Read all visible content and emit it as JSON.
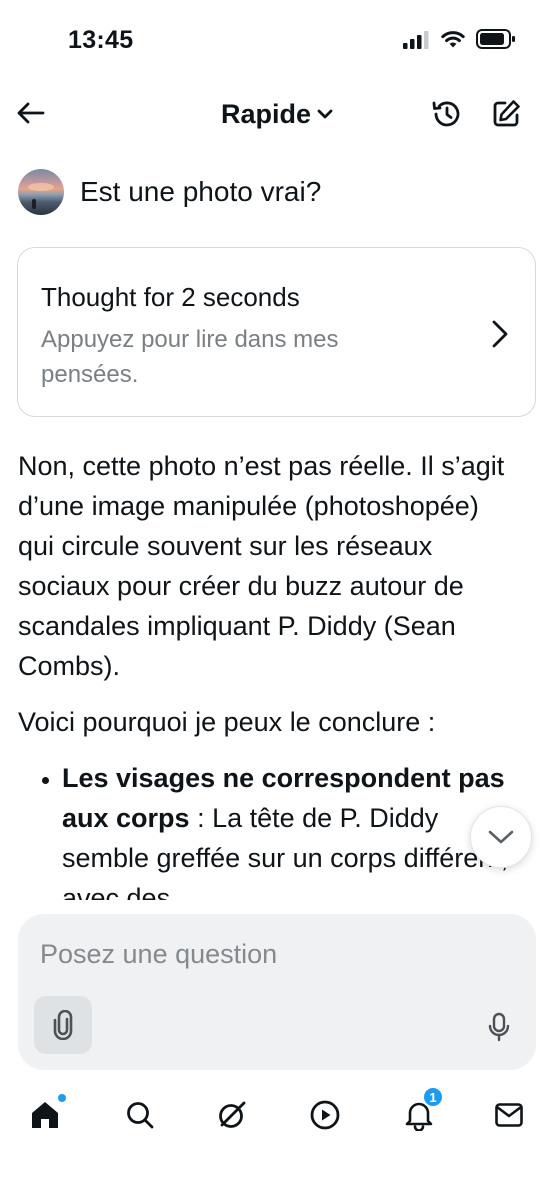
{
  "status_bar": {
    "time": "13:45",
    "icons": [
      "cellular-signal-icon",
      "wifi-icon",
      "battery-icon"
    ]
  },
  "header": {
    "title": "Rapide",
    "icons": [
      "back-arrow-icon",
      "chevron-down-icon",
      "history-icon",
      "compose-icon"
    ]
  },
  "prompt": {
    "text": "Est une photo vrai?"
  },
  "thought": {
    "title": "Thought for 2 seconds",
    "subtitle": "Appuyez pour lire dans mes pensées."
  },
  "answer": {
    "paragraph1": "Non, cette photo n’est pas réelle. Il s’agit d’une image manipulée (photoshopée) qui circule souvent sur les réseaux sociaux pour créer du buzz autour de scandales impliquant P. Diddy (Sean Combs).",
    "paragraph2": "Voici pourquoi je peux le conclure :",
    "bullets": [
      {
        "bold": "Les visages ne correspondent pas aux corps",
        "text": " : La tête de P. Diddy semble greffée sur un corps différent, avec des"
      }
    ]
  },
  "composer": {
    "placeholder": "Posez une question",
    "icons": [
      "attach-icon",
      "microphone-icon"
    ]
  },
  "bottom_nav": {
    "items": [
      "home-icon",
      "search-icon",
      "grok-icon",
      "play-icon",
      "notifications-icon",
      "messages-icon"
    ],
    "notification_count": "1"
  },
  "colors": {
    "accent": "#1d9bf0",
    "text": "#0f1419",
    "muted": "#7a7f84",
    "composer_bg": "#eff1f3"
  }
}
